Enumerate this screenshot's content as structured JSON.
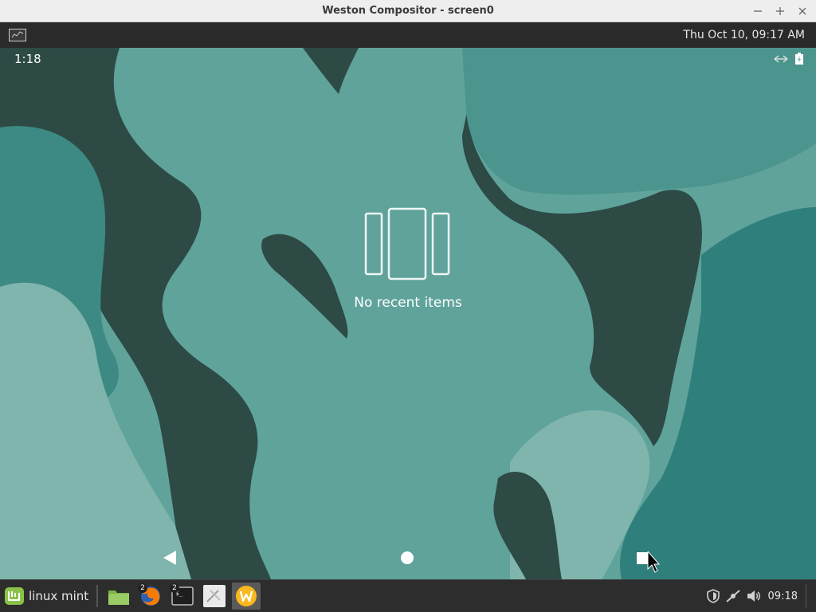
{
  "window": {
    "title": "Weston Compositor - screen0",
    "buttons": [
      "minimize",
      "maximize",
      "close"
    ]
  },
  "weston_panel": {
    "clock": "Thu Oct 10, 09:17 AM",
    "launcher_icon": "terminal-launcher-icon"
  },
  "android": {
    "status_time": "1:18",
    "status_icons": [
      "data-arrows-icon",
      "battery-icon"
    ],
    "recents": {
      "empty_label": "No recent items",
      "icon": "recents-placeholder-icon"
    },
    "nav": [
      "back-icon",
      "home-icon",
      "recents-icon"
    ],
    "colors": {
      "wallpaper_light": "#5fa39b",
      "wallpaper_dark": "#2d4a45",
      "wallpaper_pale": "#7fb5ad"
    }
  },
  "taskbar": {
    "menu_label": "linux mint",
    "apps": [
      {
        "name": "files",
        "icon": "folder-icon",
        "badge": ""
      },
      {
        "name": "firefox",
        "icon": "firefox-icon",
        "badge": "2"
      },
      {
        "name": "terminal",
        "icon": "terminal-icon",
        "badge": "2"
      },
      {
        "name": "settings",
        "icon": "settings-app-icon",
        "badge": ""
      },
      {
        "name": "weston",
        "icon": "weston-icon",
        "badge": "",
        "active": true
      }
    ],
    "tray_icons": [
      "shield-icon",
      "network-icon",
      "volume-icon"
    ],
    "clock": "09:18"
  }
}
